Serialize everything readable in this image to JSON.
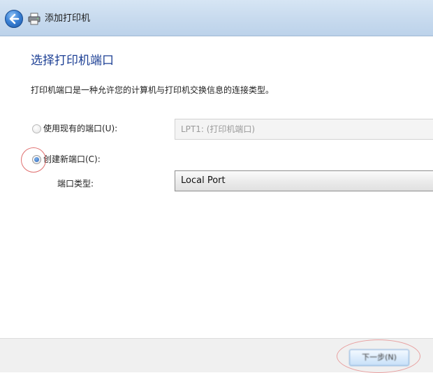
{
  "window": {
    "title": "添加打印机"
  },
  "page": {
    "title": "选择打印机端口",
    "description": "打印机端口是一种允许您的计算机与打印机交换信息的连接类型。"
  },
  "options": {
    "use_existing": {
      "label": "使用现有的端口(U):",
      "selected": false,
      "value": "LPT1: (打印机端口)"
    },
    "create_new": {
      "label": "创建新端口(C):",
      "selected": true,
      "port_type_label": "端口类型:",
      "port_type_value": "Local Port"
    }
  },
  "footer": {
    "next_label": "下一步(N)"
  },
  "colors": {
    "title_blue": "#1c3f94",
    "annotation_red": "#e07070",
    "radio_blue": "#2a63b8"
  },
  "icons": {
    "back": "back-arrow-icon",
    "printer": "printer-icon"
  }
}
